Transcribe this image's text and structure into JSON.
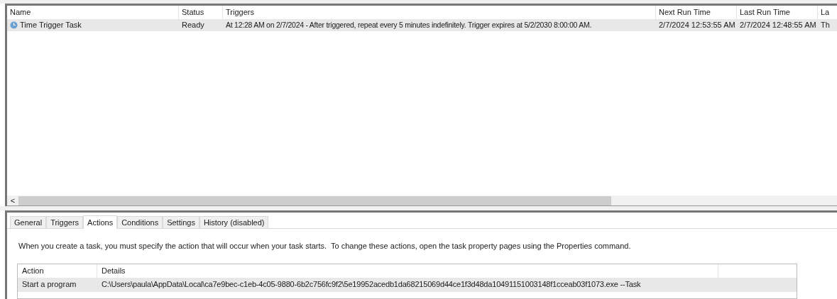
{
  "task_list": {
    "columns": [
      "Name",
      "Status",
      "Triggers",
      "Next Run Time",
      "Last Run Time",
      "La"
    ],
    "rows": [
      {
        "selected": true,
        "cells": [
          "Time Trigger Task",
          "Ready",
          "At 12:28 AM on 2/7/2024 - After triggered, repeat every 5 minutes indefinitely. Trigger expires at 5/2/2030 8:00:00 AM.",
          "2/7/2024 12:53:55 AM",
          "2/7/2024 12:48:55 AM",
          "Th"
        ]
      }
    ],
    "scroll_left": "<"
  },
  "tabs": [
    {
      "label": "General",
      "selected": false
    },
    {
      "label": "Triggers",
      "selected": false
    },
    {
      "label": "Actions",
      "selected": true
    },
    {
      "label": "Conditions",
      "selected": false
    },
    {
      "label": "Settings",
      "selected": false
    },
    {
      "label": "History (disabled)",
      "selected": false
    }
  ],
  "description": "When you create a task, you must specify the action that will occur when your task starts.  To change these actions, open the task property pages using the Properties command.",
  "actions_table": {
    "columns": [
      "Action",
      "Details"
    ],
    "rows": [
      {
        "selected": true,
        "cells": [
          "Start a program",
          "C:\\Users\\paula\\AppData\\Local\\ca7e9bec-c1eb-4c05-9880-6b2c756fc9f2\\5e19952acedb1da68215069d44ce1f3d48da10491151003148f1cceab03f1073.exe --Task"
        ]
      }
    ]
  }
}
